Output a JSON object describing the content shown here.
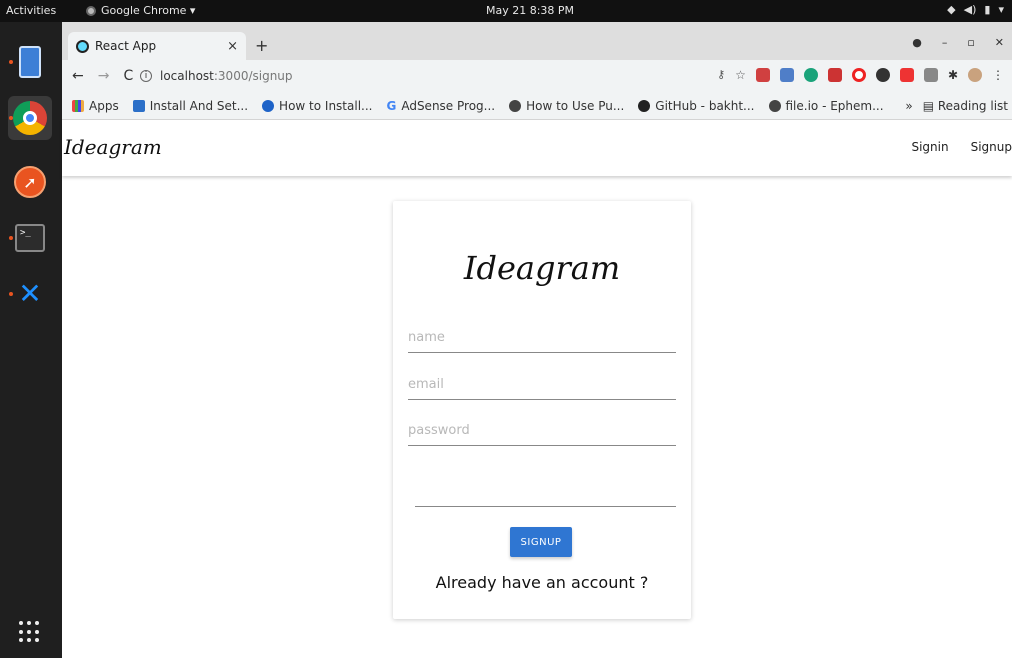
{
  "os": {
    "activities": "Activities",
    "app_menu": "Google Chrome ▾",
    "clock": "May 21  8:38 PM",
    "tray": [
      "wifi-icon",
      "volume-icon",
      "battery-icon",
      "▾"
    ]
  },
  "dock": {
    "items": [
      "files-icon",
      "chrome-icon",
      "compass-icon",
      "terminal-icon",
      "vscode-icon",
      "app-grid-icon"
    ]
  },
  "browser": {
    "tab_title": "React App",
    "tab_close": "×",
    "new_tab": "+",
    "back": "←",
    "forward": "→",
    "reload": "C",
    "url_host": "localhost",
    "url_path": ":3000/signup",
    "bookmarks": [
      {
        "label": "Apps"
      },
      {
        "label": "Install And Set..."
      },
      {
        "label": "How to Install..."
      },
      {
        "label": "AdSense Prog..."
      },
      {
        "label": "How to Use Pu..."
      },
      {
        "label": "GitHub - bakht..."
      },
      {
        "label": "file.io - Ephem..."
      }
    ],
    "more": "»",
    "reading_list": "Reading list"
  },
  "app": {
    "brand": "Ideagram",
    "nav": {
      "signin": "Signin",
      "signup": "Signup"
    },
    "card": {
      "brand": "Ideagram",
      "name_placeholder": "name",
      "email_placeholder": "email",
      "password_placeholder": "password",
      "button": "SIGNUP",
      "already": "Already have an account ?"
    }
  },
  "colors": {
    "accent": "#2f76d2",
    "dock": "#1f1f1f",
    "topbar": "#111111"
  }
}
